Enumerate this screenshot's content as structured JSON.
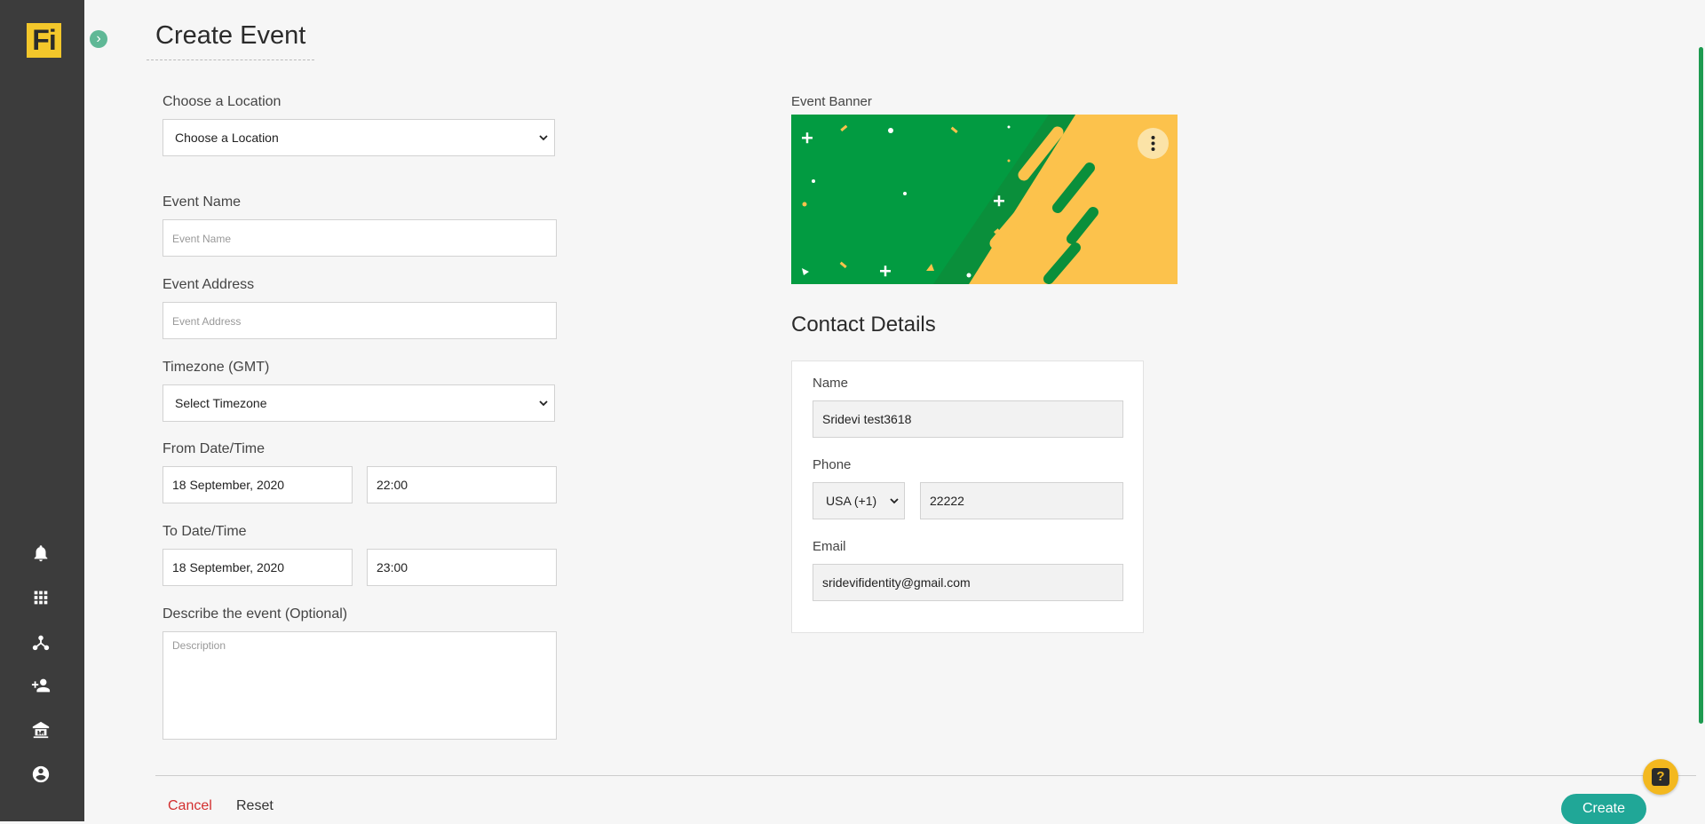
{
  "app": {
    "logo_text": "Fi"
  },
  "sidebar": {
    "items": [
      {
        "name": "notifications",
        "icon": "bell-icon"
      },
      {
        "name": "apps",
        "icon": "grid-icon"
      },
      {
        "name": "network",
        "icon": "network-icon"
      },
      {
        "name": "add-user",
        "icon": "add-user-icon"
      },
      {
        "name": "institution",
        "icon": "institution-icon"
      },
      {
        "name": "account",
        "icon": "account-circle-icon"
      }
    ]
  },
  "page": {
    "title": "Create Event"
  },
  "form": {
    "location": {
      "label": "Choose a Location",
      "selected": "Choose a Location"
    },
    "event_name": {
      "label": "Event Name",
      "placeholder": "Event Name",
      "value": ""
    },
    "event_address": {
      "label": "Event Address",
      "placeholder": "Event Address",
      "value": ""
    },
    "timezone": {
      "label": "Timezone (GMT)",
      "selected": "Select Timezone"
    },
    "from": {
      "label": "From Date/Time",
      "date": "18 September, 2020",
      "time": "22:00"
    },
    "to": {
      "label": "To Date/Time",
      "date": "18 September, 2020",
      "time": "23:00"
    },
    "description": {
      "label": "Describe the event (Optional)",
      "placeholder": "Description"
    }
  },
  "banner": {
    "label": "Event Banner"
  },
  "contact": {
    "title": "Contact Details",
    "name": {
      "label": "Name",
      "value": "Sridevi test3618"
    },
    "phone": {
      "label": "Phone",
      "country_code": "USA (+1)",
      "value": "22222"
    },
    "email": {
      "label": "Email",
      "value": "sridevifidentity@gmail.com"
    }
  },
  "actions": {
    "cancel": "Cancel",
    "reset": "Reset",
    "create": "Create"
  },
  "help": {
    "icon_text": "?"
  },
  "colors": {
    "accent": "#20a797",
    "brand": "#f3c72b",
    "banner_green": "#029b41",
    "banner_yellow": "#fcc24c",
    "cancel": "#d32f2f"
  }
}
